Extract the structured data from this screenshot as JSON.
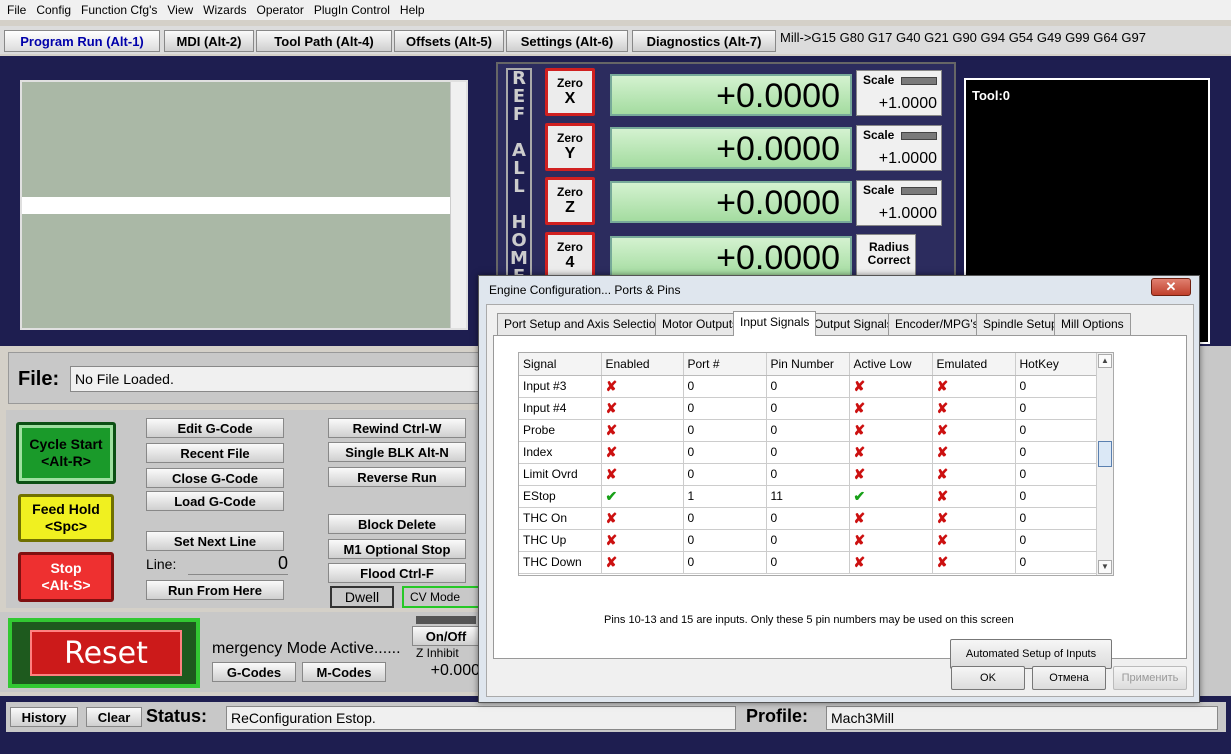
{
  "menu": [
    "File",
    "Config",
    "Function Cfg's",
    "View",
    "Wizards",
    "Operator",
    "PlugIn Control",
    "Help"
  ],
  "screen_tabs": {
    "program_run": "Program Run (Alt-1)",
    "mdi": "MDI (Alt-2)",
    "tool_path": "Tool Path (Alt-4)",
    "offsets": "Offsets (Alt-5)",
    "settings": "Settings (Alt-6)",
    "diagnostics": "Diagnostics (Alt-7)"
  },
  "modal_line": "Mill->G15  G80 G17 G40 G21 G90 G94 G54 G49 G99 G64 G97",
  "ref_all_home": "REF ALL HOME",
  "axes": [
    {
      "zero_top": "Zero",
      "zero_axis": "X",
      "value": "+0.0000",
      "scale_label": "Scale",
      "scale": "+1.0000"
    },
    {
      "zero_top": "Zero",
      "zero_axis": "Y",
      "value": "+0.0000",
      "scale_label": "Scale",
      "scale": "+1.0000"
    },
    {
      "zero_top": "Zero",
      "zero_axis": "Z",
      "value": "+0.0000",
      "scale_label": "Scale",
      "scale": "+1.0000"
    },
    {
      "zero_top": "Zero",
      "zero_axis": "4",
      "value": "+0.0000",
      "scale_label": "Radius Correct",
      "scale": ""
    }
  ],
  "tool_label": "Tool:0",
  "file": {
    "label": "File:",
    "value": "No File Loaded."
  },
  "buttons": {
    "cycle_start": [
      "Cycle Start",
      "<Alt-R>"
    ],
    "feed_hold": [
      "Feed Hold",
      "<Spc>"
    ],
    "stop": [
      "Stop",
      "<Alt-S>"
    ],
    "edit_gcode": "Edit G-Code",
    "recent_file": "Recent File",
    "close_gcode": "Close G-Code",
    "load_gcode": "Load G-Code",
    "set_next_line": "Set Next Line",
    "run_from_here": "Run From Here",
    "rewind": "Rewind Ctrl-W",
    "single_blk": "Single BLK Alt-N",
    "reverse_run": "Reverse Run",
    "block_delete": "Block Delete",
    "m1_optional_stop": "M1 Optional Stop",
    "flood": "Flood Ctrl-F",
    "dwell": "Dwell",
    "cv_mode": "CV Mode",
    "reset": "Reset",
    "on_off": "On/Off",
    "gcodes": "G-Codes",
    "mcodes": "M-Codes",
    "history": "History",
    "clear": "Clear"
  },
  "line": {
    "label": "Line:",
    "value": "0"
  },
  "emergency_text": "mergency Mode Active......",
  "z_inhibit": {
    "label": "Z Inhibit",
    "value": "+0.000"
  },
  "status": {
    "label": "Status:",
    "value": "ReConfiguration Estop."
  },
  "profile": {
    "label": "Profile:",
    "value": "Mach3Mill"
  },
  "dialog": {
    "title": "Engine Configuration... Ports & Pins",
    "close": "✕",
    "tabs": [
      "Port Setup and Axis Selection",
      "Motor Outputs",
      "Input Signals",
      "Output Signals",
      "Encoder/MPG's",
      "Spindle Setup",
      "Mill Options"
    ],
    "active_tab": "Input Signals",
    "columns": [
      "Signal",
      "Enabled",
      "Port #",
      "Pin Number",
      "Active Low",
      "Emulated",
      "HotKey"
    ],
    "rows": [
      {
        "signal": "Input #3",
        "enabled": false,
        "port": "0",
        "pin": "0",
        "active_low": false,
        "emulated": false,
        "hotkey": "0"
      },
      {
        "signal": "Input #4",
        "enabled": false,
        "port": "0",
        "pin": "0",
        "active_low": false,
        "emulated": false,
        "hotkey": "0"
      },
      {
        "signal": "Probe",
        "enabled": false,
        "port": "0",
        "pin": "0",
        "active_low": false,
        "emulated": false,
        "hotkey": "0"
      },
      {
        "signal": "Index",
        "enabled": false,
        "port": "0",
        "pin": "0",
        "active_low": false,
        "emulated": false,
        "hotkey": "0"
      },
      {
        "signal": "Limit Ovrd",
        "enabled": false,
        "port": "0",
        "pin": "0",
        "active_low": false,
        "emulated": false,
        "hotkey": "0"
      },
      {
        "signal": "EStop",
        "enabled": true,
        "port": "1",
        "pin": "11",
        "active_low": true,
        "emulated": false,
        "hotkey": "0"
      },
      {
        "signal": "THC On",
        "enabled": false,
        "port": "0",
        "pin": "0",
        "active_low": false,
        "emulated": false,
        "hotkey": "0"
      },
      {
        "signal": "THC Up",
        "enabled": false,
        "port": "0",
        "pin": "0",
        "active_low": false,
        "emulated": false,
        "hotkey": "0"
      },
      {
        "signal": "THC Down",
        "enabled": false,
        "port": "0",
        "pin": "0",
        "active_low": false,
        "emulated": false,
        "hotkey": "0"
      }
    ],
    "note": "Pins 10-13 and 15 are inputs. Only these 5 pin numbers may be used on this screen",
    "auto_setup": "Automated Setup of Inputs",
    "ok": "OK",
    "cancel": "Отмена",
    "apply": "Применить"
  }
}
